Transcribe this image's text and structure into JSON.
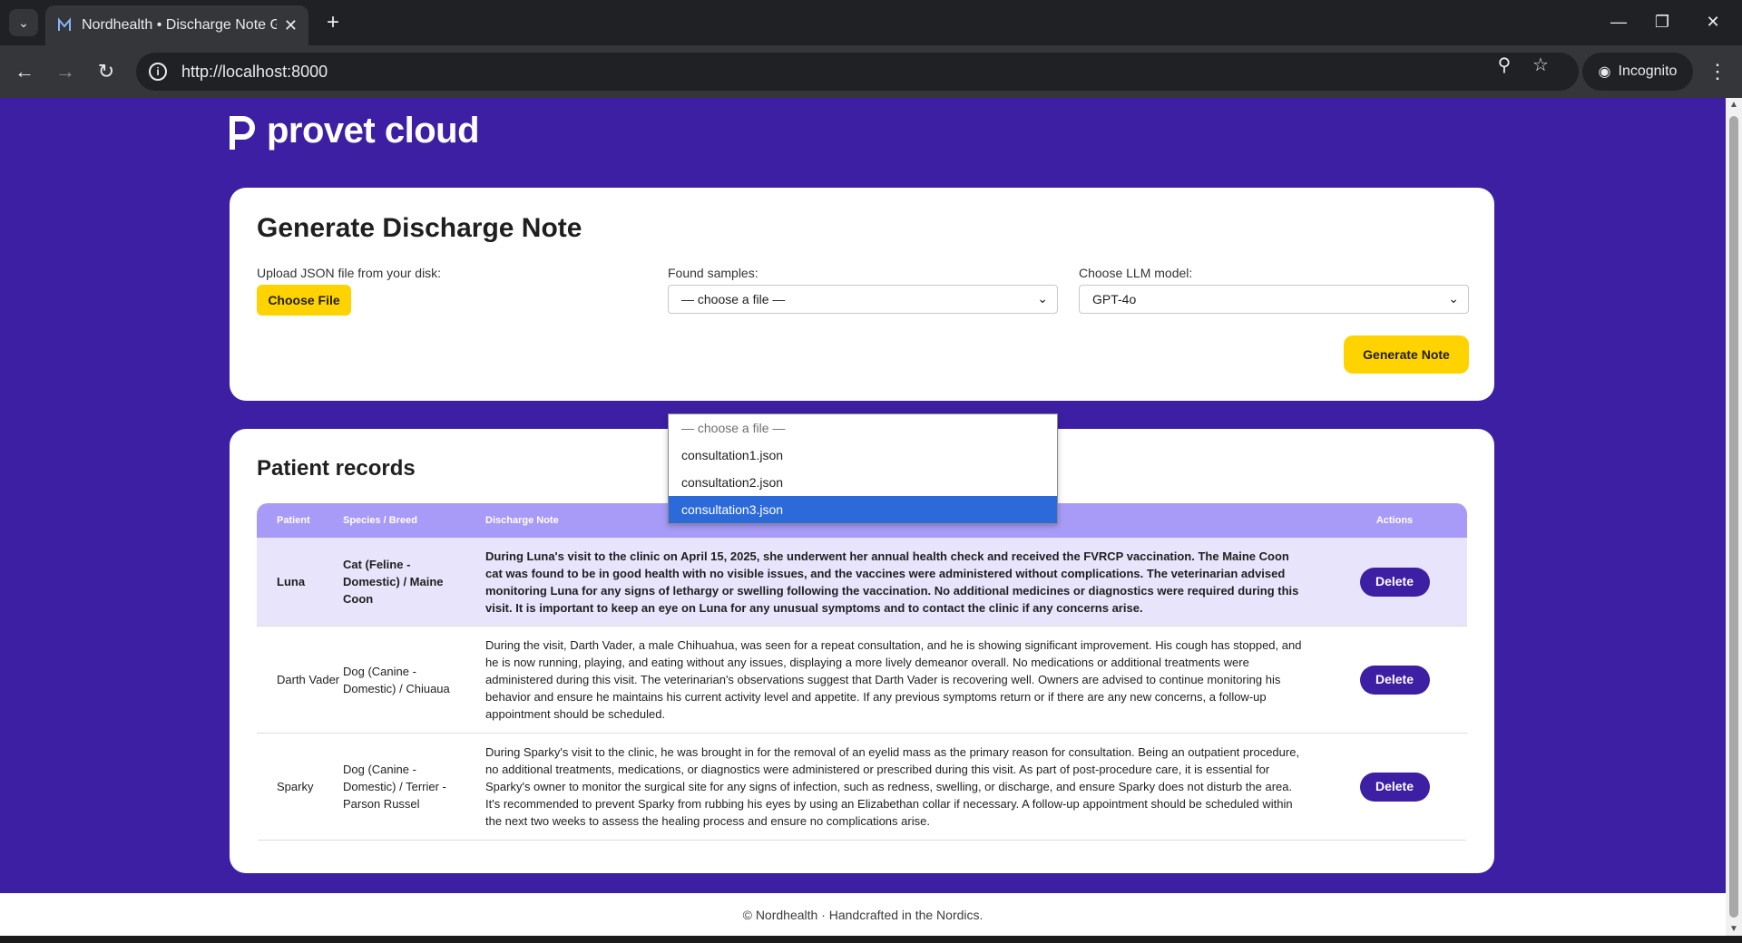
{
  "browser": {
    "tab_title": "Nordhealth • Discharge Note Generator",
    "url": "http://localhost:8000",
    "incognito_label": "Incognito"
  },
  "brand": {
    "logo_text": "provet cloud"
  },
  "form": {
    "title": "Generate Discharge Note",
    "upload_label": "Upload JSON file from your disk:",
    "choose_file_label": "Choose File",
    "samples_label": "Found samples:",
    "samples_selected": "— choose a file —",
    "samples_options": [
      "— choose a file —",
      "consultation1.json",
      "consultation2.json",
      "consultation3.json"
    ],
    "model_label": "Choose LLM model:",
    "model_selected": "GPT-4o",
    "generate_label": "Generate Note"
  },
  "records": {
    "title": "Patient records",
    "columns": [
      "Patient",
      "Species / Breed",
      "Discharge Note",
      "Actions"
    ],
    "rows": [
      {
        "patient": "Luna",
        "species": "Cat (Feline - Domestic) / Maine Coon",
        "note": "During Luna's visit to the clinic on April 15, 2025, she underwent her annual health check and received the FVRCP vaccination. The Maine Coon cat was found to be in good health with no visible issues, and the vaccines were administered without complications. The veterinarian advised monitoring Luna for any signs of lethargy or swelling following the vaccination. No additional medicines or diagnostics were required during this visit. It is important to keep an eye on Luna for any unusual symptoms and to contact the clinic if any concerns arise.",
        "action": "Delete"
      },
      {
        "patient": "Darth Vader",
        "species": "Dog (Canine - Domestic) / Chiuaua",
        "note": "During the visit, Darth Vader, a male Chihuahua, was seen for a repeat consultation, and he is showing significant improvement. His cough has stopped, and he is now running, playing, and eating without any issues, displaying a more lively demeanor overall. No medications or additional treatments were administered during this visit. The veterinarian's observations suggest that Darth Vader is recovering well. Owners are advised to continue monitoring his behavior and ensure he maintains his current activity level and appetite. If any previous symptoms return or if there are any new concerns, a follow-up appointment should be scheduled.",
        "action": "Delete"
      },
      {
        "patient": "Sparky",
        "species": "Dog (Canine - Domestic) / Terrier - Parson Russel",
        "note": "During Sparky's visit to the clinic, he was brought in for the removal of an eyelid mass as the primary reason for consultation. Being an outpatient procedure, no additional treatments, medications, or diagnostics were administered or prescribed during this visit. As part of post-procedure care, it is essential for Sparky's owner to monitor the surgical site for any signs of infection, such as redness, swelling, or discharge, and ensure Sparky does not disturb the area. It's recommended to prevent Sparky from rubbing his eyes by using an Elizabethan collar if necessary. A follow-up appointment should be scheduled within the next two weeks to assess the healing process and ensure no complications arise.",
        "action": "Delete"
      }
    ]
  },
  "footer": {
    "text": "© Nordhealth · Handcrafted in the Nordics."
  },
  "colors": {
    "brand_purple": "#3d1fa3",
    "accent_yellow": "#ffd300",
    "table_header": "#a89bf7"
  }
}
